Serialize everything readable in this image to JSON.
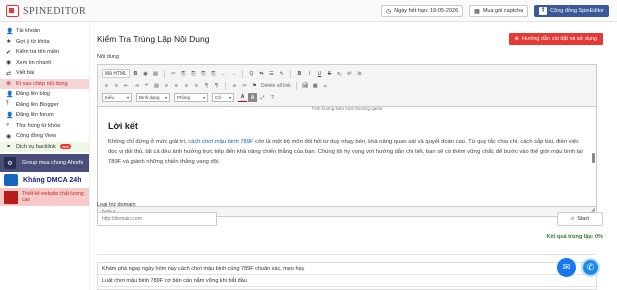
{
  "app": {
    "logo_text": "SPINEDITOR"
  },
  "header": {
    "expiry_label": "Ngày hết hạn: 19-05-2026",
    "captcha_label": "Mua gói captcha",
    "community_label": "Cộng đồng SpinEditor"
  },
  "sidebar": {
    "items": [
      {
        "label": "Tài khoản",
        "icon": "user-icon"
      },
      {
        "label": "Gợi ý từ khóa",
        "icon": "star-icon"
      },
      {
        "label": "Kiểm tra tên miền",
        "icon": "check-icon"
      },
      {
        "label": "Xem tin nhanh",
        "icon": "eye-icon"
      },
      {
        "label": "Viết bài",
        "icon": "shuffle-icon"
      },
      {
        "label": "Kt sao chép nội dung",
        "icon": "copy-icon"
      },
      {
        "label": "Đăng lên blog",
        "icon": "user-icon"
      },
      {
        "label": "Đăng lên Blogger",
        "icon": "upload-icon"
      },
      {
        "label": "Đăng lên forum",
        "icon": "user-icon"
      },
      {
        "label": "Thư hùng từ khóa",
        "icon": "search-icon"
      },
      {
        "label": "Cộng đồng View",
        "icon": "eye-icon"
      },
      {
        "label": "Dịch vụ backlink",
        "icon": "link-icon",
        "badge": "new"
      }
    ],
    "promo_group": "Group mua chung Ahrefs",
    "promo_dmca": "Kháng DMCA 24h",
    "promo_bottom": "Thiết kế website chất lượng cao"
  },
  "main": {
    "title": "Kiểm Tra Trùng Lặp Nội Dung",
    "guide_button": "Hướng dẫn cài đặt và sử dụng",
    "content_label": "Nội dung",
    "exclude_label": "Loại trừ domain",
    "exclude_placeholder": "http://domain.com",
    "start_button": "Start",
    "result_label": "Kết quả trùng lặp: 0%"
  },
  "editor": {
    "toolbar_row1": [
      "Mã HTML",
      "B",
      "◉",
      "▤",
      "✂",
      "⎘",
      "⎘",
      "⎘",
      "⎘",
      "←",
      "→",
      "Q",
      "⇆",
      "☰",
      "✎",
      "B",
      "I",
      "U",
      "S",
      "x₂",
      "x²",
      "Ix"
    ],
    "toolbar_row2": [
      "≡",
      "≡",
      "⇤",
      "⇥",
      "❝",
      "▤",
      "≡",
      "≡",
      "≡",
      "≡",
      "¶",
      "¶",
      "∞",
      "✂",
      "⚑",
      "Delete all link",
      "🖼",
      "▦",
      "☺"
    ],
    "font_select": "Kiểu",
    "format_select": "Định dạng",
    "font_family_select": "Phông",
    "font_size_select": "Cỡ",
    "image_caption": "Tình huống biến bình thường game",
    "heading": "Lời kết",
    "paragraph_before_link": "Không chỉ đứng ở mức giải trí, ",
    "paragraph_link": "cách chơi mậu binh 789F",
    "paragraph_after_link": " còn là một bộ môn đòi hỏi tư duy nhạy bén, khả năng quan sát và quyết đoán cao. Từ quy tắc chia chi, cách sắp bài, điền việc đọc vị đối thủ, tất cả đều ảnh hưởng trực tiếp đến khả năng chiến thắng của bạn. Chúng tôi hy vọng với hướng dẫn chi tiết, bạn sẽ có thêm vững chắc để bước vào thế giới mậu binh tại 789F và giành những chiến thắng vang dội.",
    "status_path": "body  p"
  },
  "results": {
    "rows": [
      "Khám phá ngay ngày hôm nay cách chơi mậu binh cùng 789F chuẩn xác, mẹo hay",
      "Luật chơi mậu binh 789F cơ bản cần nắm vững khi bắt đầu"
    ]
  }
}
